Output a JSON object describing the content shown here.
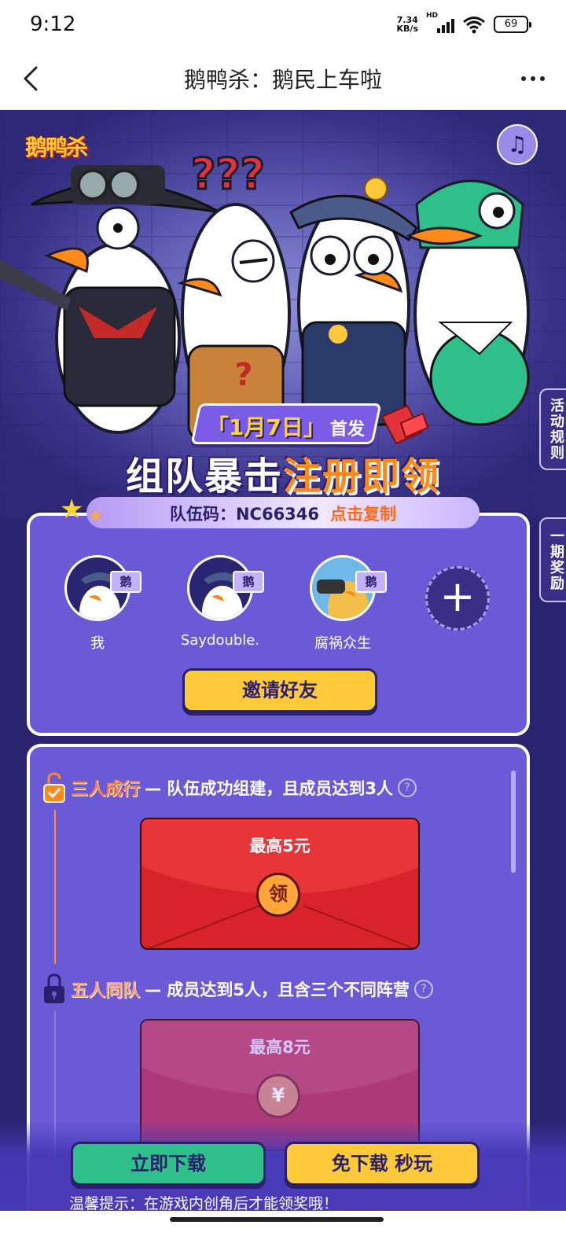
{
  "status": {
    "time": "9:12",
    "net_speed_value": "7.34",
    "net_speed_unit": "KB/s",
    "hd": "HD",
    "battery": "69"
  },
  "nav": {
    "title": "鹅鸭杀：鹅民上车啦"
  },
  "hero": {
    "logo": "鹅鸭杀",
    "date_badge": "「1月7日」",
    "date_suffix": "首发",
    "promo_white": "组队暴击",
    "promo_orange": "注册即领",
    "team_code_label": "队伍码：NC66346",
    "copy_label": "点击复制"
  },
  "side_tabs": {
    "rules": "活动规则",
    "period_reward": "一期奖励"
  },
  "team": {
    "members": [
      {
        "name": "我",
        "role": "鹅"
      },
      {
        "name": "Saydouble.",
        "role": "鹅"
      },
      {
        "name": "腐祸众生",
        "role": "鹅"
      }
    ],
    "invite_label": "邀请好友"
  },
  "rewards": {
    "tiers": [
      {
        "name": "三人成行",
        "desc": "— 队伍成功组建，且成员达到3人",
        "max": "最高5元",
        "seal": "领",
        "unlocked": true
      },
      {
        "name": "五人同队",
        "desc": "— 成员达到5人，且含三个不同阵营",
        "max": "最高8元",
        "seal": "¥",
        "unlocked": false
      }
    ]
  },
  "bottom": {
    "download_label": "立即下载",
    "play_label": "免下载 秒玩",
    "tip": "温馨提示：在游戏内创角后才能领奖哦！"
  },
  "colors": {
    "accent_yellow": "#ffc93a",
    "accent_green": "#2fbf8a",
    "card_purple": "#6b5ad6",
    "envelope_red": "#d8232a"
  }
}
